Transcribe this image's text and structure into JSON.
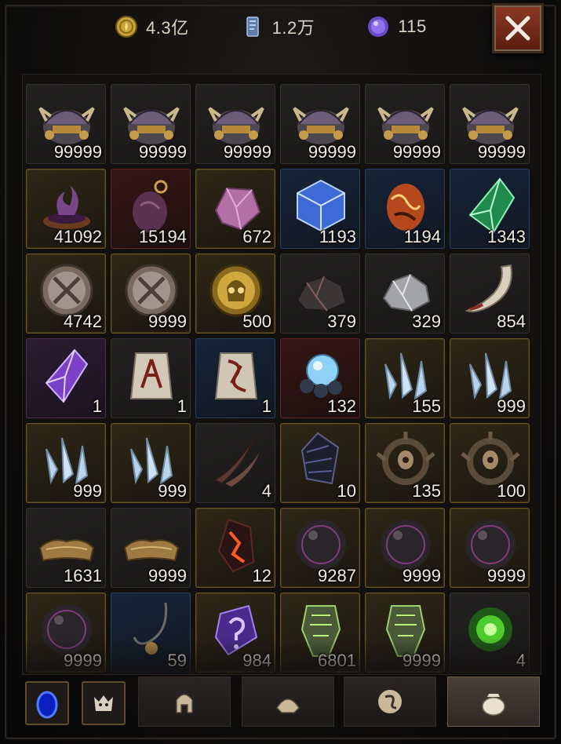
{
  "header": {
    "gold": {
      "icon": "gold-coin-icon",
      "value": "4.3亿"
    },
    "shards": {
      "icon": "crystal-shard-icon",
      "value": "1.2万"
    },
    "orbs": {
      "icon": "purple-orb-icon",
      "value": "115"
    },
    "close_icon": "close-icon"
  },
  "inventory": {
    "items": [
      {
        "icon": "demon-helm-icon",
        "rarity": "gray",
        "qty": "99999"
      },
      {
        "icon": "demon-helm-icon",
        "rarity": "gray",
        "qty": "99999"
      },
      {
        "icon": "demon-helm-icon",
        "rarity": "gray",
        "qty": "99999"
      },
      {
        "icon": "demon-helm-icon",
        "rarity": "gray",
        "qty": "99999"
      },
      {
        "icon": "demon-helm-icon",
        "rarity": "gray",
        "qty": "99999"
      },
      {
        "icon": "demon-helm-icon",
        "rarity": "gray",
        "qty": "99999"
      },
      {
        "icon": "cursed-brazier-icon",
        "rarity": "gold",
        "qty": "41092"
      },
      {
        "icon": "dark-pendant-icon",
        "rarity": "red",
        "qty": "15194"
      },
      {
        "icon": "pink-ore-icon",
        "rarity": "gold",
        "qty": "672"
      },
      {
        "icon": "blue-cube-icon",
        "rarity": "blue",
        "qty": "1193"
      },
      {
        "icon": "fire-egg-icon",
        "rarity": "blue",
        "qty": "1194"
      },
      {
        "icon": "green-crystal-icon",
        "rarity": "blue",
        "qty": "1343"
      },
      {
        "icon": "crossed-swords-medallion-icon",
        "rarity": "gold",
        "qty": "4742"
      },
      {
        "icon": "crossed-swords-medallion-icon",
        "rarity": "gold",
        "qty": "9999"
      },
      {
        "icon": "golden-skull-medallion-icon",
        "rarity": "gold",
        "qty": "500"
      },
      {
        "icon": "dark-iron-ore-icon",
        "rarity": "gray",
        "qty": "379"
      },
      {
        "icon": "silver-ore-icon",
        "rarity": "gray",
        "qty": "329"
      },
      {
        "icon": "bone-fang-icon",
        "rarity": "gray",
        "qty": "854"
      },
      {
        "icon": "violet-gem-icon",
        "rarity": "purple",
        "qty": "1"
      },
      {
        "icon": "rune-stone-icon",
        "rarity": "gray",
        "qty": "1"
      },
      {
        "icon": "rune-stone-alt-icon",
        "rarity": "blue",
        "qty": "1"
      },
      {
        "icon": "spirit-orb-cluster-icon",
        "rarity": "red",
        "qty": "132"
      },
      {
        "icon": "ice-shards-icon",
        "rarity": "gold",
        "qty": "155"
      },
      {
        "icon": "ice-shards-icon",
        "rarity": "gold",
        "qty": "999"
      },
      {
        "icon": "ice-shards-icon",
        "rarity": "gold",
        "qty": "999"
      },
      {
        "icon": "ice-shards-icon",
        "rarity": "gold",
        "qty": "999"
      },
      {
        "icon": "curved-horns-icon",
        "rarity": "gray",
        "qty": "4"
      },
      {
        "icon": "black-scale-icon",
        "rarity": "gold",
        "qty": "10"
      },
      {
        "icon": "eye-ring-icon",
        "rarity": "gold",
        "qty": "135"
      },
      {
        "icon": "eye-ring-icon",
        "rarity": "gold",
        "qty": "100"
      },
      {
        "icon": "leather-hide-icon",
        "rarity": "gray",
        "qty": "1631"
      },
      {
        "icon": "leather-hide-icon",
        "rarity": "gray",
        "qty": "9999"
      },
      {
        "icon": "molten-stone-icon",
        "rarity": "gold",
        "qty": "12"
      },
      {
        "icon": "void-sphere-icon",
        "rarity": "gold",
        "qty": "9287"
      },
      {
        "icon": "void-sphere-icon",
        "rarity": "gold",
        "qty": "9999"
      },
      {
        "icon": "void-sphere-icon",
        "rarity": "gold",
        "qty": "9999"
      },
      {
        "icon": "void-sphere-icon",
        "rarity": "gold",
        "qty": "9999"
      },
      {
        "icon": "fishing-hook-icon",
        "rarity": "blue",
        "qty": "59"
      },
      {
        "icon": "mystery-rune-icon",
        "rarity": "gold",
        "qty": "984"
      },
      {
        "icon": "green-idol-icon",
        "rarity": "gold",
        "qty": "6801"
      },
      {
        "icon": "green-idol-icon",
        "rarity": "gold",
        "qty": "9999"
      },
      {
        "icon": "green-flame-orb-icon",
        "rarity": "gray",
        "qty": "4"
      }
    ]
  },
  "tabs": [
    {
      "icon": "portal-ring-icon",
      "kind": "small"
    },
    {
      "icon": "demon-emblem-icon",
      "kind": "small"
    },
    {
      "icon": "helmet-icon",
      "kind": "big",
      "active": false
    },
    {
      "icon": "armor-piece-icon",
      "kind": "big",
      "active": false
    },
    {
      "icon": "swirl-rune-icon",
      "kind": "big",
      "active": false
    },
    {
      "icon": "pouch-icon",
      "kind": "big",
      "active": true
    }
  ]
}
